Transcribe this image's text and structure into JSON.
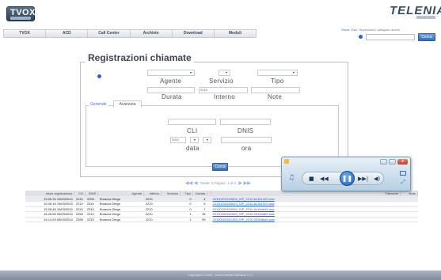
{
  "header": {
    "logo_text": "TVOX",
    "brand_text": "TELENIA"
  },
  "menu": [
    "TVOX",
    "ACD",
    "Call Center",
    "Archivio",
    "Download",
    "Moduli"
  ],
  "user": {
    "links": [
      "Storia",
      "Esci"
    ],
    "status": "Supervisore collegato: admin"
  },
  "search": {
    "button_label": "Cerca"
  },
  "form": {
    "title": "Registrazioni chiamate",
    "labels": {
      "agente": "Agente",
      "servizio": "Servizio",
      "tipo": "Tipo",
      "durata": "Durata",
      "interno": "Interno",
      "note": "Note",
      "cli": "CLI",
      "dnis": "DNIS",
      "data": "data",
      "ora": "ora"
    },
    "interno_value": "2210",
    "date_year": "2010",
    "tabs": [
      "Generale",
      "Avanzata"
    ],
    "cerca_label": "Cerca"
  },
  "pager": {
    "prev": "◀◀ ◀",
    "text": "Totale: 5  Pagine: 1 di 1",
    "next": "▶ ▶▶"
  },
  "table": {
    "headers": [
      "Inizio registrazione",
      "CLI",
      "DNIS",
      "Agente",
      "Interno",
      "Servizio",
      "Tipo",
      "Durata",
      "",
      "Filename",
      "Note"
    ],
    "rows": [
      {
        "inizio": "15.06.34 19/03/2010",
        "cli": "2210",
        "dnis": "2298",
        "agente": "Buracca Diego",
        "interno": "2210",
        "servizio": "",
        "tipo": "0",
        "durata": "4",
        "file": "20100319150634_SIP_2210-6x161409.wav"
      },
      {
        "inizio": "15.06.15 19/03/2010",
        "cli": "2210",
        "dnis": "2310",
        "agente": "Buracca Diego",
        "interno": "2210",
        "servizio": "",
        "tipo": "0",
        "durata": "5",
        "file": "20100319150615_SIP_2210-6x161910.wav"
      },
      {
        "inizio": "15.05.46 19/03/2010",
        "cli": "2210",
        "dnis": "2315",
        "agente": "Buracca Diego",
        "interno": "2210",
        "servizio": "",
        "tipo": "0",
        "durata": "7",
        "file": "20100319150546_SIP_2210-6x15de45.wav"
      },
      {
        "inizio": "16.26.59 05/03/2010",
        "cli": "2298",
        "dnis": "2210",
        "agente": "Buracca Diego",
        "interno": "2210",
        "servizio": "",
        "tipo": "1",
        "durata": "33",
        "file": "20100305162659_SIP_2210-093e2a65.wav"
      },
      {
        "inizio": "16.14.53 05/03/2010",
        "cli": "2298",
        "dnis": "2210",
        "agente": "Buracca Diego",
        "interno": "2210",
        "servizio": "",
        "tipo": "1",
        "durata": "59",
        "file": "20100305161453_SIP_2210-093b8ba6.wav"
      }
    ]
  },
  "player": {
    "close": "x",
    "prev": "◀◀",
    "stop": "■",
    "play": "❚❚",
    "next": "▶▶|",
    "volume": "◀)"
  },
  "footer": {
    "text": "Copyright © 2006 - 2010 Telenia Software S.r.l."
  }
}
